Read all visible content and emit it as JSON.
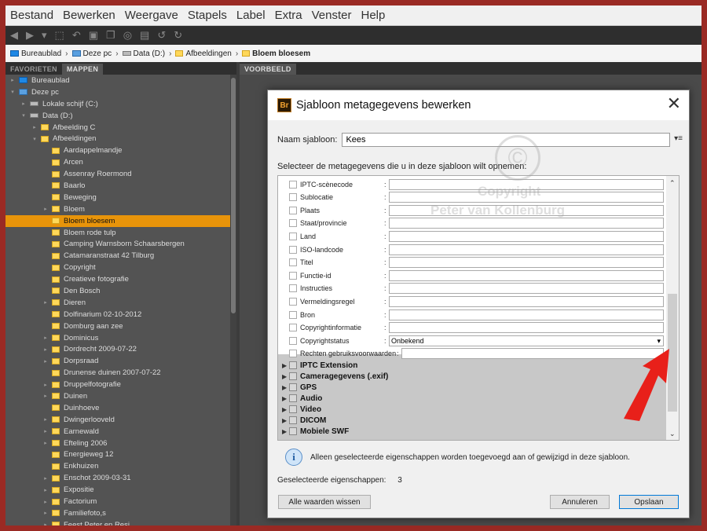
{
  "menu": [
    "Bestand",
    "Bewerken",
    "Weergave",
    "Stapels",
    "Label",
    "Extra",
    "Venster",
    "Help"
  ],
  "path": [
    {
      "label": "Bureaublad",
      "icon": "desktop-icon"
    },
    {
      "label": "Deze pc",
      "icon": "pc-icon"
    },
    {
      "label": "Data (D:)",
      "icon": "drive-icon"
    },
    {
      "label": "Afbeeldingen",
      "icon": "folder-icon"
    },
    {
      "label": "Bloem bloesem",
      "icon": "folder-icon"
    }
  ],
  "left_tabs": [
    "FAVORIETEN",
    "MAPPEN"
  ],
  "right_tab": "VOORBEELD",
  "tree": [
    {
      "label": "Bureaublad",
      "indent": 0,
      "icon": "desktop",
      "arrow": "▸"
    },
    {
      "label": "Deze pc",
      "indent": 0,
      "icon": "pc",
      "arrow": "▾"
    },
    {
      "label": "Lokale schijf (C:)",
      "indent": 1,
      "icon": "drive",
      "arrow": "▸"
    },
    {
      "label": "Data (D:)",
      "indent": 1,
      "icon": "drive",
      "arrow": "▾"
    },
    {
      "label": "Afbeelding C",
      "indent": 2,
      "icon": "folder",
      "arrow": "▸"
    },
    {
      "label": "Afbeeldingen",
      "indent": 2,
      "icon": "folder",
      "arrow": "▾"
    },
    {
      "label": "Aardappelmandje",
      "indent": 3,
      "icon": "folder",
      "arrow": ""
    },
    {
      "label": "Arcen",
      "indent": 3,
      "icon": "folder",
      "arrow": ""
    },
    {
      "label": "Assenray Roermond",
      "indent": 3,
      "icon": "folder",
      "arrow": ""
    },
    {
      "label": "Baarlo",
      "indent": 3,
      "icon": "folder",
      "arrow": ""
    },
    {
      "label": "Beweging",
      "indent": 3,
      "icon": "folder",
      "arrow": ""
    },
    {
      "label": "Bloem",
      "indent": 3,
      "icon": "folder",
      "arrow": "▸"
    },
    {
      "label": "Bloem bloesem",
      "indent": 3,
      "icon": "folder",
      "arrow": "",
      "selected": true
    },
    {
      "label": "Bloem rode tulp",
      "indent": 3,
      "icon": "folder",
      "arrow": ""
    },
    {
      "label": "Camping Warnsborn Schaarsbergen",
      "indent": 3,
      "icon": "folder",
      "arrow": ""
    },
    {
      "label": "Catamaranstraat 42 Tilburg",
      "indent": 3,
      "icon": "folder",
      "arrow": ""
    },
    {
      "label": "Copyright",
      "indent": 3,
      "icon": "folder",
      "arrow": ""
    },
    {
      "label": "Creatieve fotografie",
      "indent": 3,
      "icon": "folder",
      "arrow": ""
    },
    {
      "label": "Den Bosch",
      "indent": 3,
      "icon": "folder",
      "arrow": ""
    },
    {
      "label": "Dieren",
      "indent": 3,
      "icon": "folder",
      "arrow": "▸"
    },
    {
      "label": "Dolfinarium 02-10-2012",
      "indent": 3,
      "icon": "folder",
      "arrow": ""
    },
    {
      "label": "Domburg aan zee",
      "indent": 3,
      "icon": "folder",
      "arrow": ""
    },
    {
      "label": "Dominicus",
      "indent": 3,
      "icon": "folder",
      "arrow": "▸"
    },
    {
      "label": "Dordrecht 2009-07-22",
      "indent": 3,
      "icon": "folder",
      "arrow": "▸"
    },
    {
      "label": "Dorpsraad",
      "indent": 3,
      "icon": "folder",
      "arrow": "▸"
    },
    {
      "label": "Drunense duinen 2007-07-22",
      "indent": 3,
      "icon": "folder",
      "arrow": ""
    },
    {
      "label": "Druppelfotografie",
      "indent": 3,
      "icon": "folder",
      "arrow": "▸"
    },
    {
      "label": "Duinen",
      "indent": 3,
      "icon": "folder",
      "arrow": "▸"
    },
    {
      "label": "Duinhoeve",
      "indent": 3,
      "icon": "folder",
      "arrow": ""
    },
    {
      "label": "Dwingerlooveld",
      "indent": 3,
      "icon": "folder",
      "arrow": "▸"
    },
    {
      "label": "Earnewald",
      "indent": 3,
      "icon": "folder",
      "arrow": "▸"
    },
    {
      "label": "Efteling 2006",
      "indent": 3,
      "icon": "folder",
      "arrow": "▸"
    },
    {
      "label": "Energieweg 12",
      "indent": 3,
      "icon": "folder",
      "arrow": ""
    },
    {
      "label": "Enkhuizen",
      "indent": 3,
      "icon": "folder",
      "arrow": ""
    },
    {
      "label": "Enschot 2009-03-31",
      "indent": 3,
      "icon": "folder",
      "arrow": "▸"
    },
    {
      "label": "Expositie",
      "indent": 3,
      "icon": "folder",
      "arrow": "▸"
    },
    {
      "label": "Factorium",
      "indent": 3,
      "icon": "folder",
      "arrow": "▸"
    },
    {
      "label": "Familiefoto,s",
      "indent": 3,
      "icon": "folder",
      "arrow": "▸"
    },
    {
      "label": "Feest Peter en Resi",
      "indent": 3,
      "icon": "folder",
      "arrow": "▸"
    }
  ],
  "dialog": {
    "title": "Sjabloon metagegevens bewerken",
    "logo": "Br",
    "name_label": "Naam sjabloon:",
    "name_value": "Kees",
    "instruction": "Selecteer de metagegevens die u in deze sjabloon wilt opnemen:",
    "fields": [
      {
        "label": "IPTC-scènecode",
        "value": ""
      },
      {
        "label": "Sublocatie",
        "value": ""
      },
      {
        "label": "Plaats",
        "value": ""
      },
      {
        "label": "Staat/provincie",
        "value": ""
      },
      {
        "label": "Land",
        "value": ""
      },
      {
        "label": "ISO-landcode",
        "value": ""
      },
      {
        "label": "Titel",
        "value": ""
      },
      {
        "label": "Functie-id",
        "value": ""
      },
      {
        "label": "Instructies",
        "value": ""
      },
      {
        "label": "Vermeldingsregel",
        "value": ""
      },
      {
        "label": "Bron",
        "value": ""
      },
      {
        "label": "Copyrightinformatie",
        "value": ""
      },
      {
        "label": "Copyrightstatus",
        "value": "Onbekend",
        "dropdown": true
      },
      {
        "label": "Rechten gebruiksvoorwaarden",
        "value": ""
      }
    ],
    "groups": [
      "IPTC Extension",
      "Cameragegevens (.exif)",
      "GPS",
      "Audio",
      "Video",
      "DICOM",
      "Mobiele SWF"
    ],
    "info_text": "Alleen geselecteerde eigenschappen worden toegevoegd aan of gewijzigd in deze sjabloon.",
    "selected_label": "Geselecteerde eigenschappen:",
    "selected_count": "3",
    "clear_button": "Alle waarden wissen",
    "cancel_button": "Annuleren",
    "save_button": "Opslaan"
  },
  "watermark": {
    "symbol": "©",
    "line1": "Copyright",
    "line2": "Peter van Kollenburg"
  },
  "colors": {
    "border": "#9a2a24",
    "selection": "#e8940a",
    "arrow": "#e8201a"
  }
}
